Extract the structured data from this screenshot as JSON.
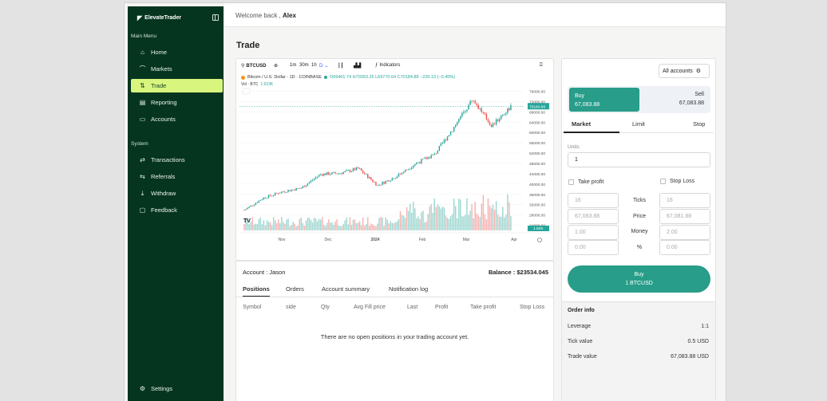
{
  "brand": {
    "name": "ElevateTrader"
  },
  "sidebar": {
    "main_menu_label": "Main Menu",
    "system_label": "System",
    "main_items": [
      {
        "label": "Home",
        "icon": "home-icon"
      },
      {
        "label": "Markets",
        "icon": "markets-icon"
      },
      {
        "label": "Trade",
        "icon": "trade-icon",
        "active": true
      },
      {
        "label": "Reporting",
        "icon": "reporting-icon"
      },
      {
        "label": "Accounts",
        "icon": "accounts-icon"
      }
    ],
    "system_items": [
      {
        "label": "Transactions",
        "icon": "transactions-icon"
      },
      {
        "label": "Referrals",
        "icon": "referrals-icon"
      },
      {
        "label": "Withdraw",
        "icon": "withdraw-icon"
      },
      {
        "label": "Feedback",
        "icon": "feedback-icon"
      }
    ],
    "settings_label": "Settings"
  },
  "topbar": {
    "welcome_prefix": "Welcome back ,",
    "user_name": "Alex"
  },
  "page": {
    "title": "Trade"
  },
  "chart": {
    "symbol": "BTCUSD",
    "intervals": [
      "1m",
      "30m",
      "1h",
      "D"
    ],
    "indicators_label": "Indicators",
    "series_title": "Bitcoin / U.S. Dollar · 1D · COINBASE",
    "ohlc": "O69401.74 H70363.25 L69770.64 C70184.88 −220.13 (−0.40%)",
    "vol_label": "Vol · BTC",
    "vol_value": "1.623K",
    "price_tag": "70184.88",
    "vol_tag": "1.62K",
    "tv_logo": "TV"
  },
  "chart_data": {
    "type": "candlestick",
    "x_tick_labels": [
      "Nov",
      "Dec",
      "2024",
      "Feb",
      "Mar",
      "Apr"
    ],
    "y_tick_labels": [
      "76000.00",
      "72000.00",
      "68000.00",
      "64000.00",
      "60000.00",
      "56000.00",
      "52000.00",
      "48000.00",
      "44000.00",
      "40000.00",
      "36000.00",
      "32000.00",
      "28000.00",
      "24000.00"
    ],
    "ylim": [
      22000,
      78000
    ],
    "approx_close_path": [
      {
        "x": "Oct 21",
        "y": 29900
      },
      {
        "x": "Nov 1",
        "y": 34600
      },
      {
        "x": "Nov 15",
        "y": 37000
      },
      {
        "x": "Dec 1",
        "y": 38500
      },
      {
        "x": "Dec 10",
        "y": 43800
      },
      {
        "x": "Jan 1",
        "y": 44200
      },
      {
        "x": "Jan 12",
        "y": 46000
      },
      {
        "x": "Jan 23",
        "y": 39500
      },
      {
        "x": "Feb 1",
        "y": 43000
      },
      {
        "x": "Feb 10",
        "y": 48000
      },
      {
        "x": "Feb 20",
        "y": 51500
      },
      {
        "x": "Mar 1",
        "y": 62000
      },
      {
        "x": "Mar 14",
        "y": 73000
      },
      {
        "x": "Mar 20",
        "y": 62500
      },
      {
        "x": "Apr 1",
        "y": 70184.88
      }
    ]
  },
  "account": {
    "label": "Account : Jason",
    "balance": "Balance : $23534.045"
  },
  "position_tabs": [
    "Positions",
    "Orders",
    "Account summary",
    "Notification log"
  ],
  "position_columns": [
    "Symbol",
    "side",
    "Qty",
    "Avg Fill price",
    "Last",
    "Profit",
    "Take profit",
    "Stop Loss"
  ],
  "positions_empty": "There are no open positions in your trading account yet.",
  "order": {
    "accounts_select": "All accounts",
    "buy_label": "Buy",
    "buy_price": "67,083.88",
    "sell_label": "Sell",
    "sell_price": "67,083.88",
    "tabs": [
      "Market",
      "Limit",
      "Stop"
    ],
    "units_label": "Units",
    "units_value": "1",
    "take_profit_label": "Take profit",
    "stop_loss_label": "Stop Loss",
    "mid_labels": [
      "Ticks",
      "Price",
      "Money",
      "%"
    ],
    "tp_values": [
      "16",
      "67,083.88",
      "1.00",
      "0.00"
    ],
    "sl_values": [
      "16",
      "67,081.88",
      "2.00",
      "0.00"
    ],
    "submit_line1": "Buy",
    "submit_line2": "1 BTCUSD",
    "info_title": "Order info",
    "info_rows": [
      {
        "label": "Leverage",
        "value": "1:1"
      },
      {
        "label": "Tick value",
        "value": "0.5 USD"
      },
      {
        "label": "Trade value",
        "value": "67,083.88 USD"
      }
    ]
  },
  "colors": {
    "sidebar_bg": "#06351f",
    "active_nav": "#d8f57e",
    "accent": "#289d89",
    "up": "#26a69a",
    "down": "#ef5350"
  }
}
